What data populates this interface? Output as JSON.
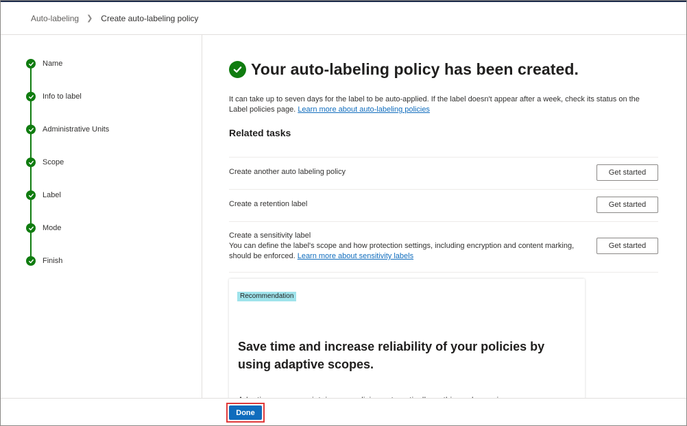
{
  "breadcrumb": {
    "parent": "Auto-labeling",
    "current": "Create auto-labeling policy"
  },
  "steps": [
    {
      "label": "Name",
      "status": "complete"
    },
    {
      "label": "Info to label",
      "status": "complete"
    },
    {
      "label": "Administrative Units",
      "status": "complete"
    },
    {
      "label": "Scope",
      "status": "complete"
    },
    {
      "label": "Label",
      "status": "complete"
    },
    {
      "label": "Mode",
      "status": "complete"
    },
    {
      "label": "Finish",
      "status": "complete"
    }
  ],
  "main": {
    "title": "Your auto-labeling policy has been created.",
    "description": "It can take up to seven days for the label to be auto-applied. If the label doesn't appear after a week, check its status on the Label policies page.",
    "description_link": "Learn more about auto-labeling policies",
    "related_heading": "Related tasks",
    "tasks": [
      {
        "title": "Create another auto labeling policy",
        "button": "Get started"
      },
      {
        "title": "Create a retention label",
        "button": "Get started"
      },
      {
        "title": "Create a sensitivity label",
        "description": "You can define the label's scope and how protection settings, including encryption and content marking, should be enforced.",
        "link": "Learn more about sensitivity labels",
        "button": "Get started"
      }
    ]
  },
  "recommendation": {
    "badge": "Recommendation",
    "title": "Save time and increase reliability of your policies by using adaptive scopes.",
    "text": "Adaptive scopes maintain your policies automatically as things change in your"
  },
  "footer": {
    "done_label": "Done"
  },
  "colors": {
    "success": "#107c10",
    "primary": "#0f6cbd",
    "badge": "#9fe3eb",
    "highlight": "#e03a3a"
  }
}
